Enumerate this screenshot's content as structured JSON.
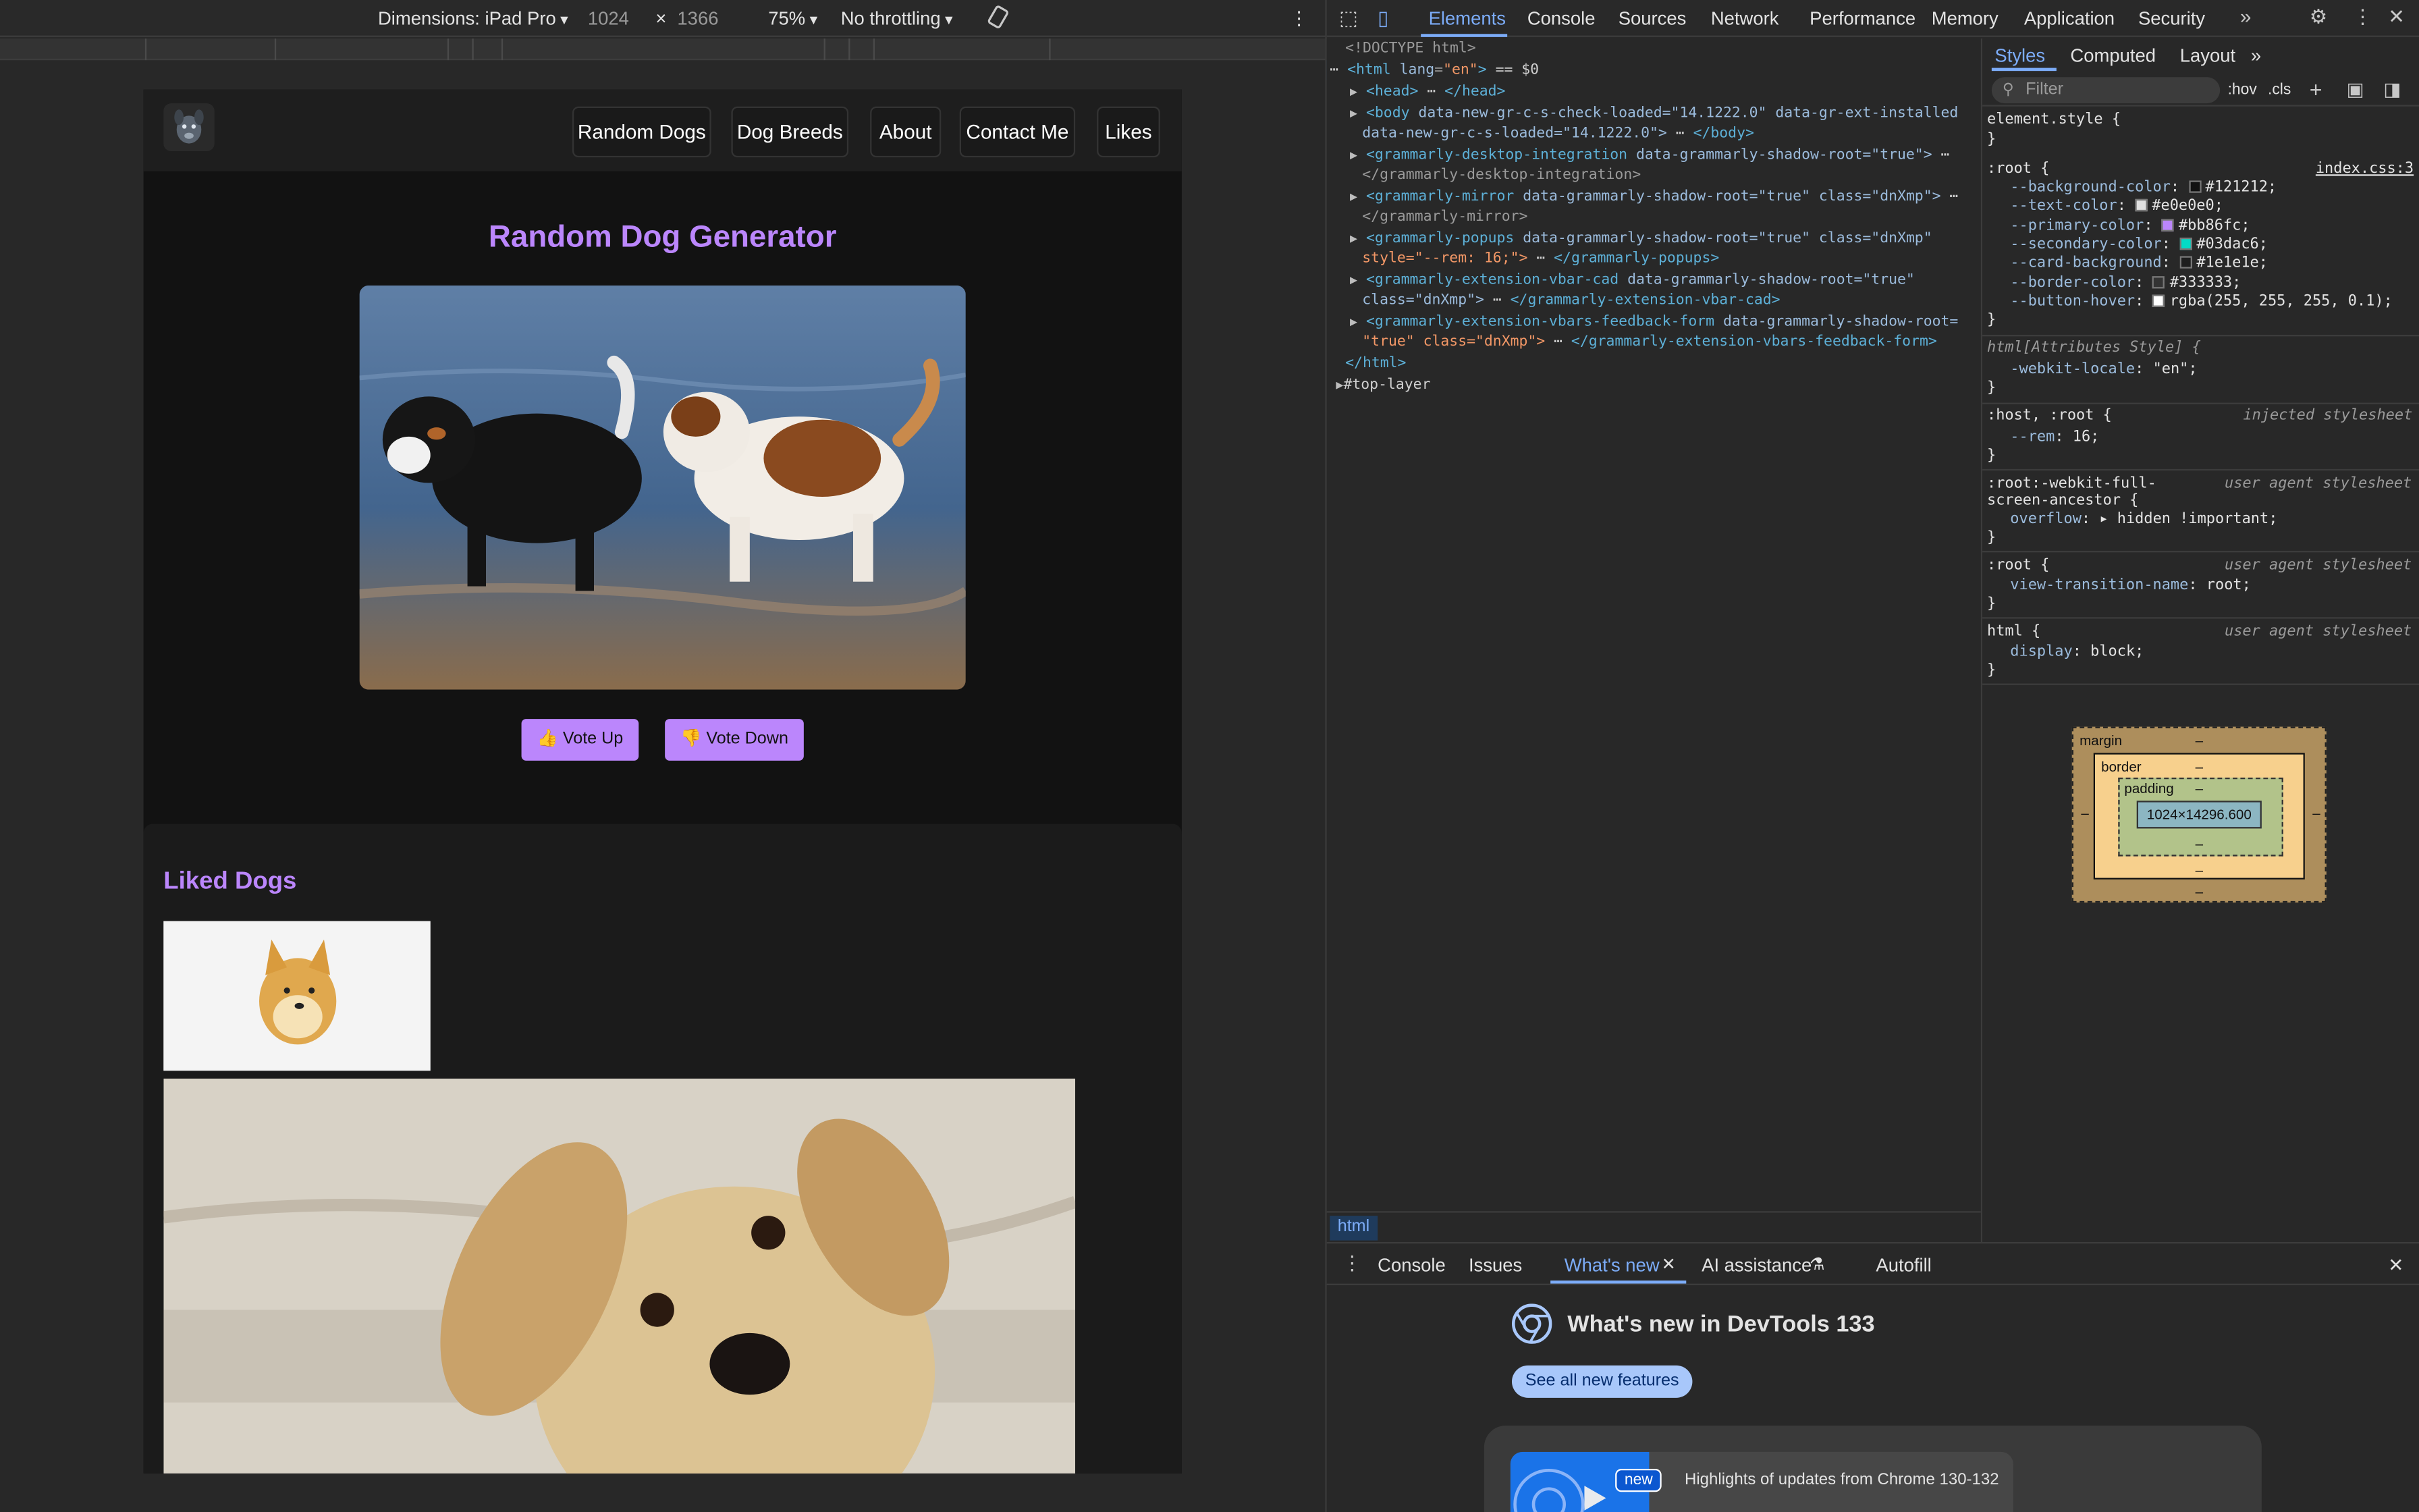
{
  "device_toolbar": {
    "dimensions_label": "Dimensions: iPad Pro",
    "width": "1024",
    "times": "×",
    "height": "1366",
    "zoom": "75%",
    "throttling": "No throttling"
  },
  "site": {
    "nav": [
      "Random Dogs",
      "Dog Breeds",
      "About",
      "Contact Me",
      "Likes"
    ],
    "title": "Random Dog Generator",
    "vote_up": "👍 Vote Up",
    "vote_down": "👎 Vote Down",
    "liked_title": "Liked Dogs"
  },
  "devtools": {
    "tabs": [
      "Elements",
      "Console",
      "Sources",
      "Network",
      "Performance",
      "Memory",
      "Application",
      "Security"
    ],
    "dom": {
      "doctype": "<!DOCTYPE html>",
      "html_open": "html",
      "lang_attr": "lang",
      "lang_val": "\"en\"",
      "sel_eq": "== $0",
      "head": "head",
      "body": "body",
      "body_attrs": "data-new-gr-c-s-check-loaded=\"14.1222.0\" data-gr-ext-installed",
      "body_attrs2": "data-new-gr-c-s-loaded=\"14.1222.0\">",
      "body_close": "</body>",
      "gdi": "grammarly-desktop-integration",
      "gdi_attr": "data-grammarly-shadow-root=\"true\">",
      "gdi_close": "</grammarly-desktop-integration>",
      "gm": "grammarly-mirror",
      "gm_attr": "data-grammarly-shadow-root=\"true\" class=\"dnXmp\">",
      "gm_close": "</grammarly-mirror>",
      "gp": "grammarly-popups",
      "gp_attr": "data-grammarly-shadow-root=\"true\" class=\"dnXmp\"",
      "gp_style": "style=\"--rem: 16;\">",
      "gp_close": "</grammarly-popups>",
      "gv": "grammarly-extension-vbar-cad",
      "gv_attr": "data-grammarly-shadow-root=\"true\"",
      "gv_class": "class=\"dnXmp\">",
      "gv_close": "</grammarly-extension-vbar-cad>",
      "gf": "grammarly-extension-vbars-feedback-form",
      "gf_attr": "data-grammarly-shadow-root=",
      "gf_attr2": "\"true\" class=\"dnXmp\">",
      "gf_close": "</grammarly-extension-vbars-feedback-form>",
      "html_close": "</html>",
      "top_layer": "#top-layer"
    },
    "breadcrumb": "html",
    "styles": {
      "tabs": [
        "Styles",
        "Computed",
        "Layout"
      ],
      "filter_placeholder": "Filter",
      "hov": ":hov",
      "cls": ".cls",
      "element_style": "element.style {",
      "close": "}",
      "root_sel": ":root {",
      "root_src": "index.css:3",
      "vars": [
        {
          "name": "--background-color",
          "value": "#121212",
          "color": "#121212"
        },
        {
          "name": "--text-color",
          "value": "#e0e0e0",
          "color": "#e0e0e0"
        },
        {
          "name": "--primary-color",
          "value": "#bb86fc",
          "color": "#bb86fc"
        },
        {
          "name": "--secondary-color",
          "value": "#03dac6",
          "color": "#03dac6"
        },
        {
          "name": "--card-background",
          "value": "#1e1e1e",
          "color": "#1e1e1e"
        },
        {
          "name": "--border-color",
          "value": "#333333",
          "color": "#333333"
        },
        {
          "name": "--button-hover",
          "value": "rgba(255, 255, 255, 0.1)",
          "color": "#ffffff"
        }
      ],
      "attr_sel": "html[Attributes Style] {",
      "attr_prop": "-webkit-locale",
      "attr_val": "\"en\";",
      "host_sel": ":host, :root {",
      "host_src": "injected stylesheet",
      "host_prop": "--rem",
      "host_val": "16;",
      "fs_sel": ":root:-webkit-full-",
      "fs_sel2": "screen-ancestor {",
      "ua_src": "user agent stylesheet",
      "fs_prop": "overflow",
      "fs_val": "▸ hidden !important;",
      "vt_sel": ":root {",
      "vt_prop": "view-transition-name",
      "vt_val": "root;",
      "html_sel": "html {",
      "disp_prop": "display",
      "disp_val": "block;"
    },
    "box_model": {
      "margin": "margin",
      "border": "border",
      "padding": "padding",
      "content": "1024×14296.600",
      "dash": "–"
    },
    "drawer": {
      "tabs": [
        "Console",
        "Issues",
        "What's new",
        "AI assistance",
        "Autofill"
      ],
      "title": "What's new in DevTools 133",
      "button": "See all new features",
      "badge": "new",
      "highlight": "Highlights of updates from Chrome 130-132"
    }
  }
}
